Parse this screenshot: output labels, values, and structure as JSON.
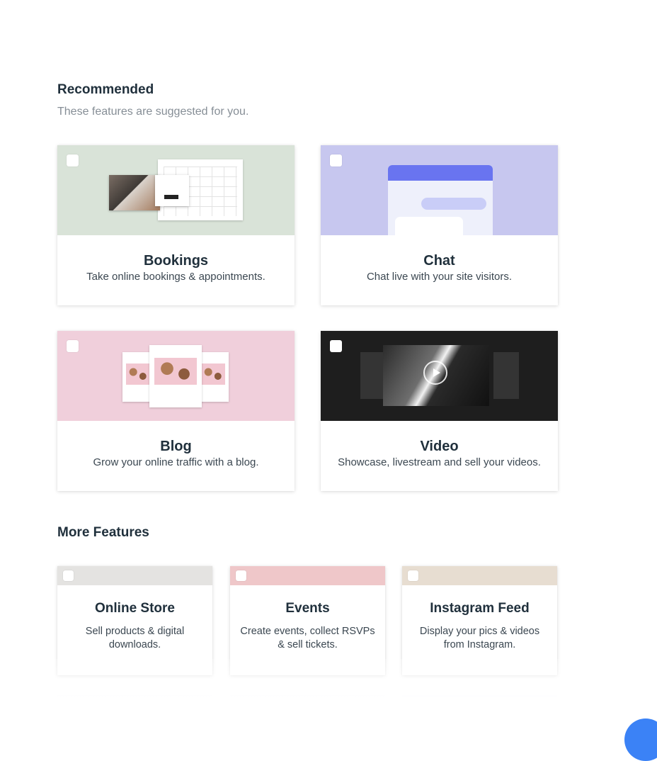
{
  "recommended": {
    "title": "Recommended",
    "subtitle": "These features are suggested for you.",
    "cards": [
      {
        "title": "Bookings",
        "desc": "Take online bookings & appointments.",
        "bg": "#d9e3d8"
      },
      {
        "title": "Chat",
        "desc": "Chat live with your site visitors.",
        "bg": "#c7c7ef"
      },
      {
        "title": "Blog",
        "desc": "Grow your online traffic with a blog.",
        "bg": "#f0cfdb"
      },
      {
        "title": "Video",
        "desc": "Showcase, livestream and sell your videos.",
        "bg": "#1e1e1e"
      }
    ]
  },
  "more": {
    "title": "More Features",
    "cards": [
      {
        "title": "Online Store",
        "desc": "Sell products & digital downloads.",
        "bg": "#e4e3e1"
      },
      {
        "title": "Events",
        "desc": "Create events, collect RSVPs & sell tickets.",
        "bg": "#efc7c9"
      },
      {
        "title": "Instagram Feed",
        "desc": "Display your pics & videos from Instagram.",
        "bg": "#e7ddd1"
      }
    ]
  },
  "icons": {
    "checkbox": "checkbox-icon",
    "play": "play-icon"
  }
}
